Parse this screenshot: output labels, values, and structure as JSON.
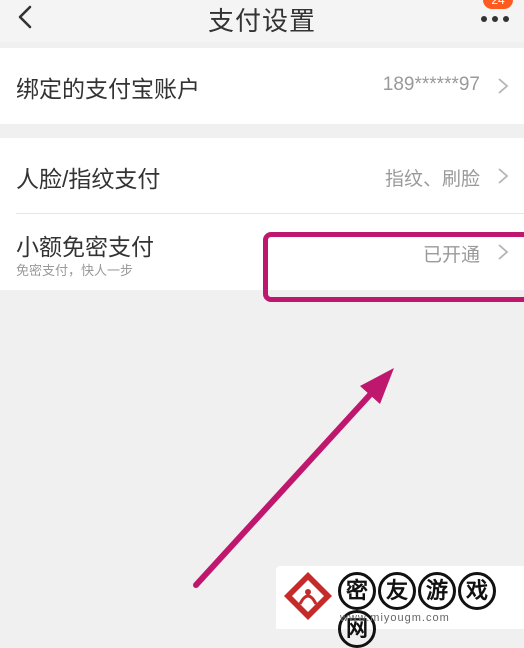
{
  "nav": {
    "title": "支付设置",
    "badge_count": "24"
  },
  "group1": {
    "alipay": {
      "label": "绑定的支付宝账户",
      "value": "189******97"
    }
  },
  "group2": {
    "face_finger": {
      "label": "人脸/指纹支付",
      "value": "指纹、刷脸"
    },
    "small_pay": {
      "label": "小额免密支付",
      "sublabel": "免密支付，快人一步",
      "value": "已开通"
    }
  },
  "annotation": {
    "color": "#c0176e"
  },
  "watermark": {
    "chars": [
      "密",
      "友",
      "游",
      "戏",
      "网"
    ],
    "url": "www.miyougm.com"
  }
}
